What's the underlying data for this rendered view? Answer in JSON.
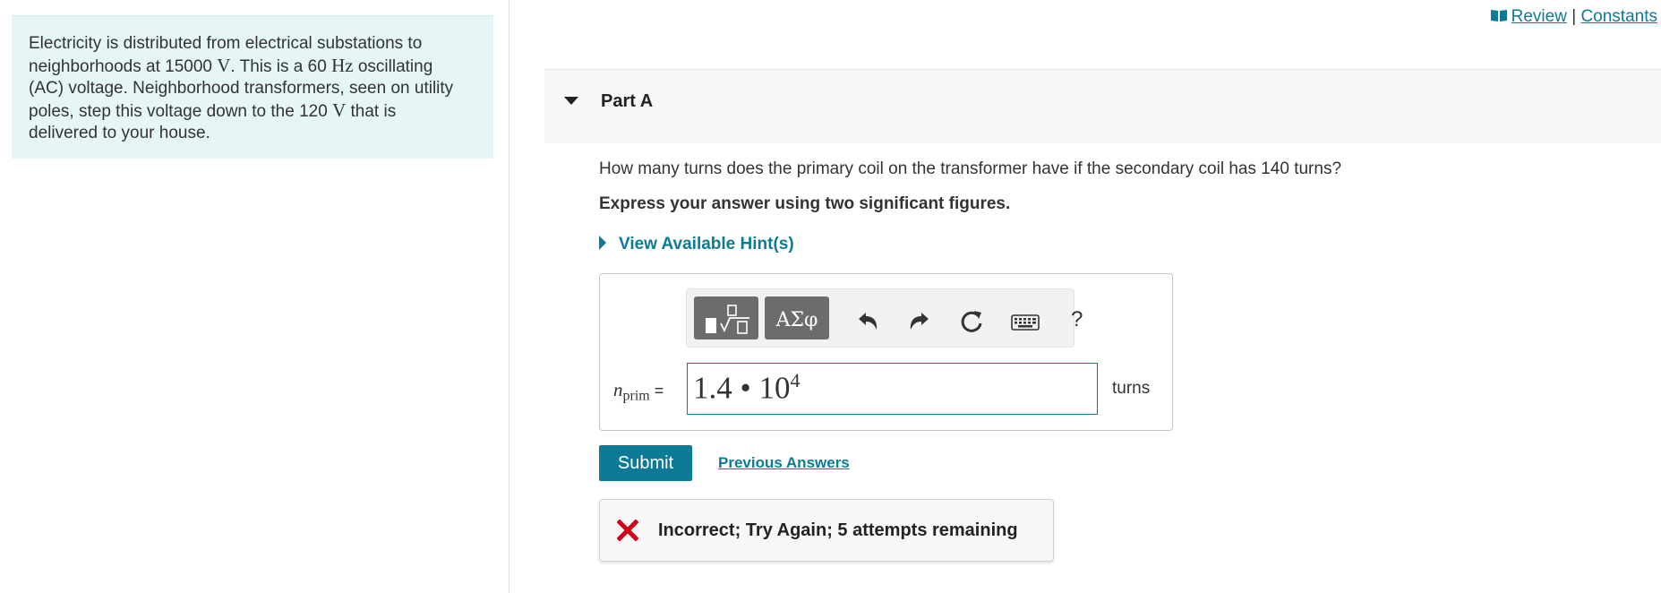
{
  "problem": {
    "line1_a": "Electricity is distributed from electrical substations to",
    "line2_a": "neighborhoods at 15000 ",
    "line2_unit1": "V",
    "line2_b": ". This is a 60 ",
    "line2_unit2": "Hz",
    "line2_c": " oscillating",
    "line3": "(AC) voltage. Neighborhood transformers, seen on utility",
    "line4_a": "poles, step this voltage down to the 120 ",
    "line4_unit": "V",
    "line4_b": " that is",
    "line5": "delivered to your house."
  },
  "links": {
    "review": "Review",
    "separator": "|",
    "constants": "Constants"
  },
  "part": {
    "title": "Part A",
    "question": "How many turns does the primary coil on the transformer have if the secondary coil has 140 turns?",
    "instruction": "Express your answer using two significant figures.",
    "hint_label": "View Available Hint(s)"
  },
  "toolbar": {
    "greek_label": "ΑΣφ",
    "help_label": "?"
  },
  "answer": {
    "variable": "n",
    "variable_sub": "prim",
    "equals": "=",
    "mantissa": "1.4",
    "operator": "•",
    "base": "10",
    "exponent": "4",
    "unit": "turns"
  },
  "actions": {
    "submit": "Submit",
    "previous_answers": "Previous Answers"
  },
  "feedback": {
    "message": "Incorrect; Try Again; 5 attempts remaining",
    "status_color": "#d0021b"
  },
  "colors": {
    "accent": "#0e7a95",
    "problem_bg": "#e6f5f5",
    "part_header_bg": "#f7f7f7",
    "toolbar_button": "#6c6c6c"
  }
}
